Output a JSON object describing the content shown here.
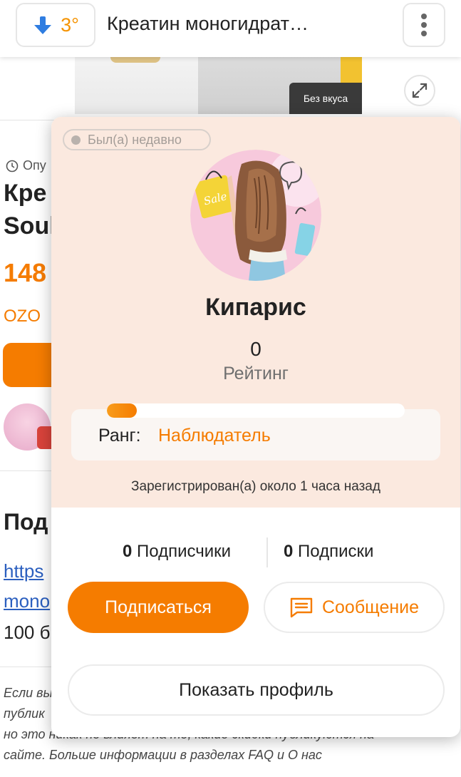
{
  "topbar": {
    "temperature": "3°",
    "title": "Креатин моногидрат…"
  },
  "product": {
    "flavor_badge": "Без вкуса",
    "published_prefix": "Опу",
    "title_line1": "Кре",
    "title_line2": "Soul",
    "price": "148",
    "store": "OZO",
    "section_title": "Под",
    "link_line1": "https",
    "link_line2": "mono",
    "weight": "100 б",
    "note_line1": "Если вы",
    "note_line2": "публик",
    "note_line3": "но это никак не влияет на то, какие скидки публикуются на",
    "note_line4": "сайте. Больше информации в разделах FAQ и О нас"
  },
  "popup": {
    "status": "Был(а) недавно",
    "username": "Кипарис",
    "rating_value": "0",
    "rating_label": "Рейтинг",
    "rank_progress": 0.1,
    "rank_label": "Ранг:",
    "rank_value": "Наблюдатель",
    "registered": "Зарегистрирован(а) около 1 часа назад",
    "followers_count": "0",
    "followers_label": "Подписчики",
    "following_count": "0",
    "following_label": "Подписки",
    "subscribe_label": "Подписаться",
    "message_label": "Сообщение",
    "show_profile_label": "Показать профиль"
  },
  "colors": {
    "accent": "#f57c00",
    "popup_header_bg": "#fbe9df",
    "temperature": "#f59300",
    "arrow": "#2f7de1"
  }
}
